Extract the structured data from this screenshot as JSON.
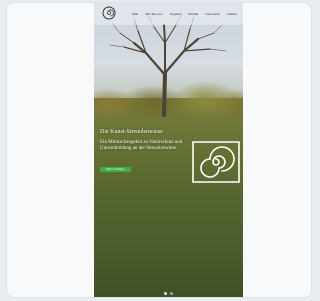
{
  "site": {
    "logo_icon": "spiral-logo-icon"
  },
  "nav": {
    "items": [
      "Start",
      "Wir über uns",
      "Angebot",
      "Kontakt",
      "Impressum",
      "Galerie"
    ]
  },
  "hero": {
    "title": "Die Kunst-Streuobstwiese",
    "subtitle": "Ein Mitmachangebot zu Naturschutz und Umweltbildung an der Streuobstwiese",
    "cta_label": "Mehr erfahren"
  },
  "emblem": {
    "icon": "spiral-emblem-icon"
  },
  "colors": {
    "accent": "#3fae49",
    "text_light": "#ffffff"
  }
}
